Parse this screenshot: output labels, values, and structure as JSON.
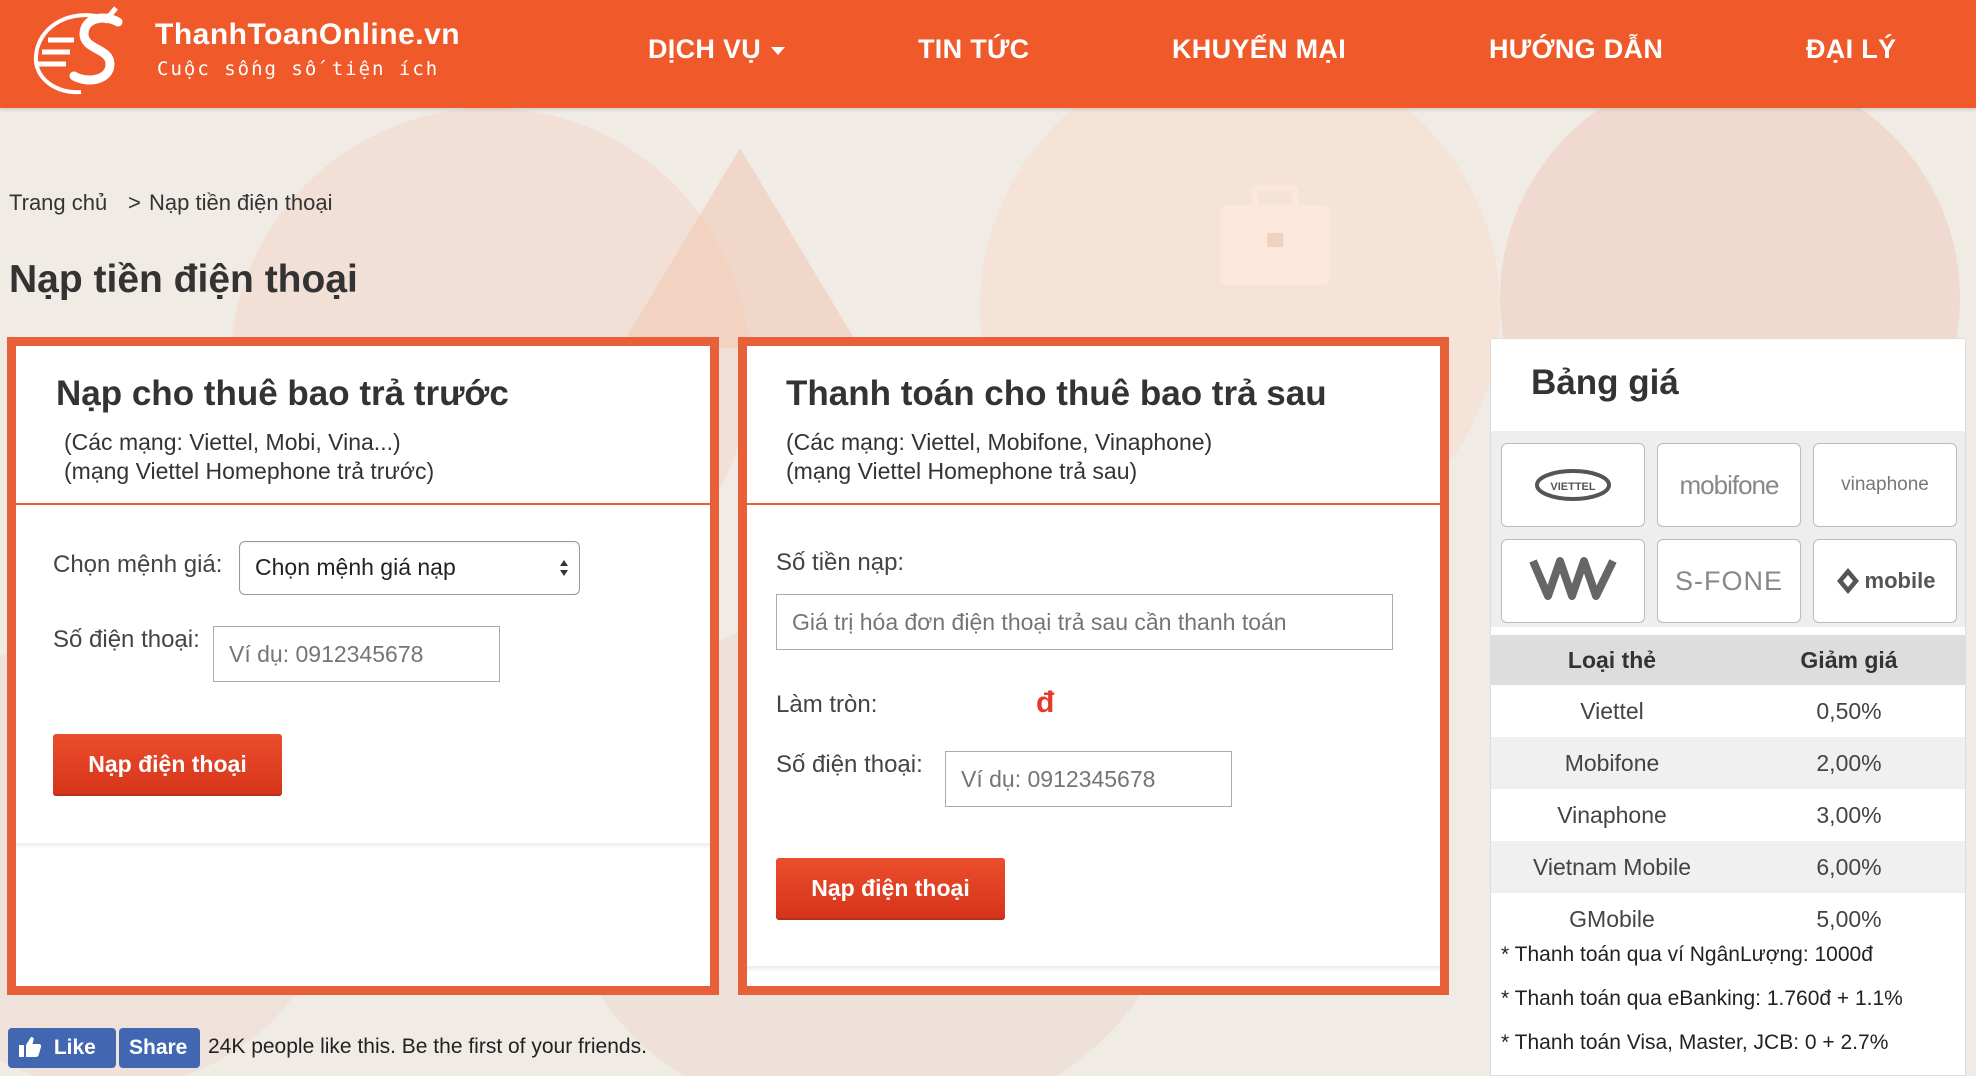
{
  "brand": {
    "name": "ThanhToanOnline.vn",
    "tagline": "Cuộc sống số tiện ích",
    "accent": "#f05a2b"
  },
  "nav": {
    "items": [
      {
        "label": "DỊCH VỤ",
        "has_dropdown": true
      },
      {
        "label": "TIN TỨC"
      },
      {
        "label": "KHUYẾN MẠI"
      },
      {
        "label": "HƯỚNG DẪN"
      },
      {
        "label": "ĐẠI LÝ"
      }
    ]
  },
  "breadcrumb": {
    "home": "Trang chủ",
    "separator": ">",
    "current": "Nạp tiền điện thoại"
  },
  "page_title": "Nạp tiền điện thoại",
  "prepaid": {
    "title": "Nạp cho thuê bao trả trước",
    "sub1": "(Các mạng: Viettel, Mobi, Vina...)",
    "sub2": "(mạng Viettel Homephone trả trước)",
    "amount_label": "Chọn mệnh giá:",
    "amount_select": "Chọn mệnh giá nạp",
    "phone_label": "Số điện thoại:",
    "phone_placeholder": "Ví dụ: 0912345678",
    "submit": "Nạp điện thoại"
  },
  "postpaid": {
    "title": "Thanh toán cho thuê bao trả sau",
    "sub1": "(Các mạng: Viettel, Mobifone, Vinaphone)",
    "sub2": "(mạng Viettel Homephone trả sau)",
    "amount_label": "Số tiền nạp:",
    "amount_placeholder": "Giá trị hóa đơn điện thoại trả sau cần thanh toán",
    "round_label": "Làm tròn:",
    "currency": "đ",
    "phone_label": "Số điện thoại:",
    "phone_placeholder": "Ví dụ: 0912345678",
    "submit": "Nạp điện thoại"
  },
  "price_table": {
    "title": "Bảng giá",
    "logos": [
      "VIETTEL",
      "mobifone",
      "vinaphone",
      "VM",
      "S-FONE",
      "mobile"
    ],
    "headers": [
      "Loại thẻ",
      "Giảm giá"
    ],
    "rows": [
      [
        "Viettel",
        "0,50%"
      ],
      [
        "Mobifone",
        "2,00%"
      ],
      [
        "Vinaphone",
        "3,00%"
      ],
      [
        "Vietnam Mobile",
        "6,00%"
      ],
      [
        "GMobile",
        "5,00%"
      ]
    ],
    "notes": [
      "* Thanh toán qua ví NgânLượng: 1000đ",
      "* Thanh toán qua eBanking: 1.760đ + 1.1%",
      "* Thanh toán Visa, Master, JCB: 0 + 2.7%"
    ]
  },
  "facebook": {
    "like": "Like",
    "share": "Share",
    "text": "24K people like this. Be the first of your friends."
  }
}
